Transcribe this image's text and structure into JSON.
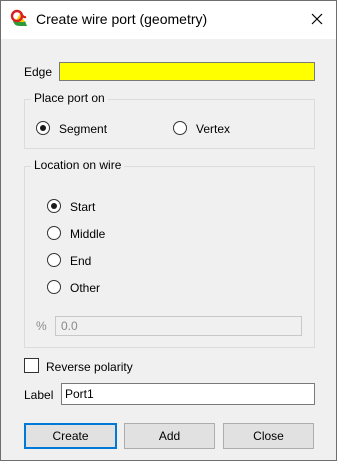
{
  "window": {
    "title": "Create wire port (geometry)",
    "app_icon": "cst-app-icon",
    "close_icon": "close-icon"
  },
  "edge": {
    "label": "Edge",
    "value": "",
    "highlight_color": "#ffff00"
  },
  "place_port_on": {
    "title": "Place port on",
    "options": [
      {
        "label": "Segment",
        "selected": true
      },
      {
        "label": "Vertex",
        "selected": false
      }
    ]
  },
  "location_on_wire": {
    "title": "Location on wire",
    "options": [
      {
        "label": "Start",
        "selected": true
      },
      {
        "label": "Middle",
        "selected": false
      },
      {
        "label": "End",
        "selected": false
      },
      {
        "label": "Other",
        "selected": false
      }
    ],
    "percent_label": "%",
    "percent_value": "0.0"
  },
  "reverse_polarity": {
    "label": "Reverse polarity",
    "checked": false
  },
  "port_label": {
    "label": "Label",
    "value": "Port1"
  },
  "buttons": {
    "create": "Create",
    "add": "Add",
    "close": "Close"
  }
}
